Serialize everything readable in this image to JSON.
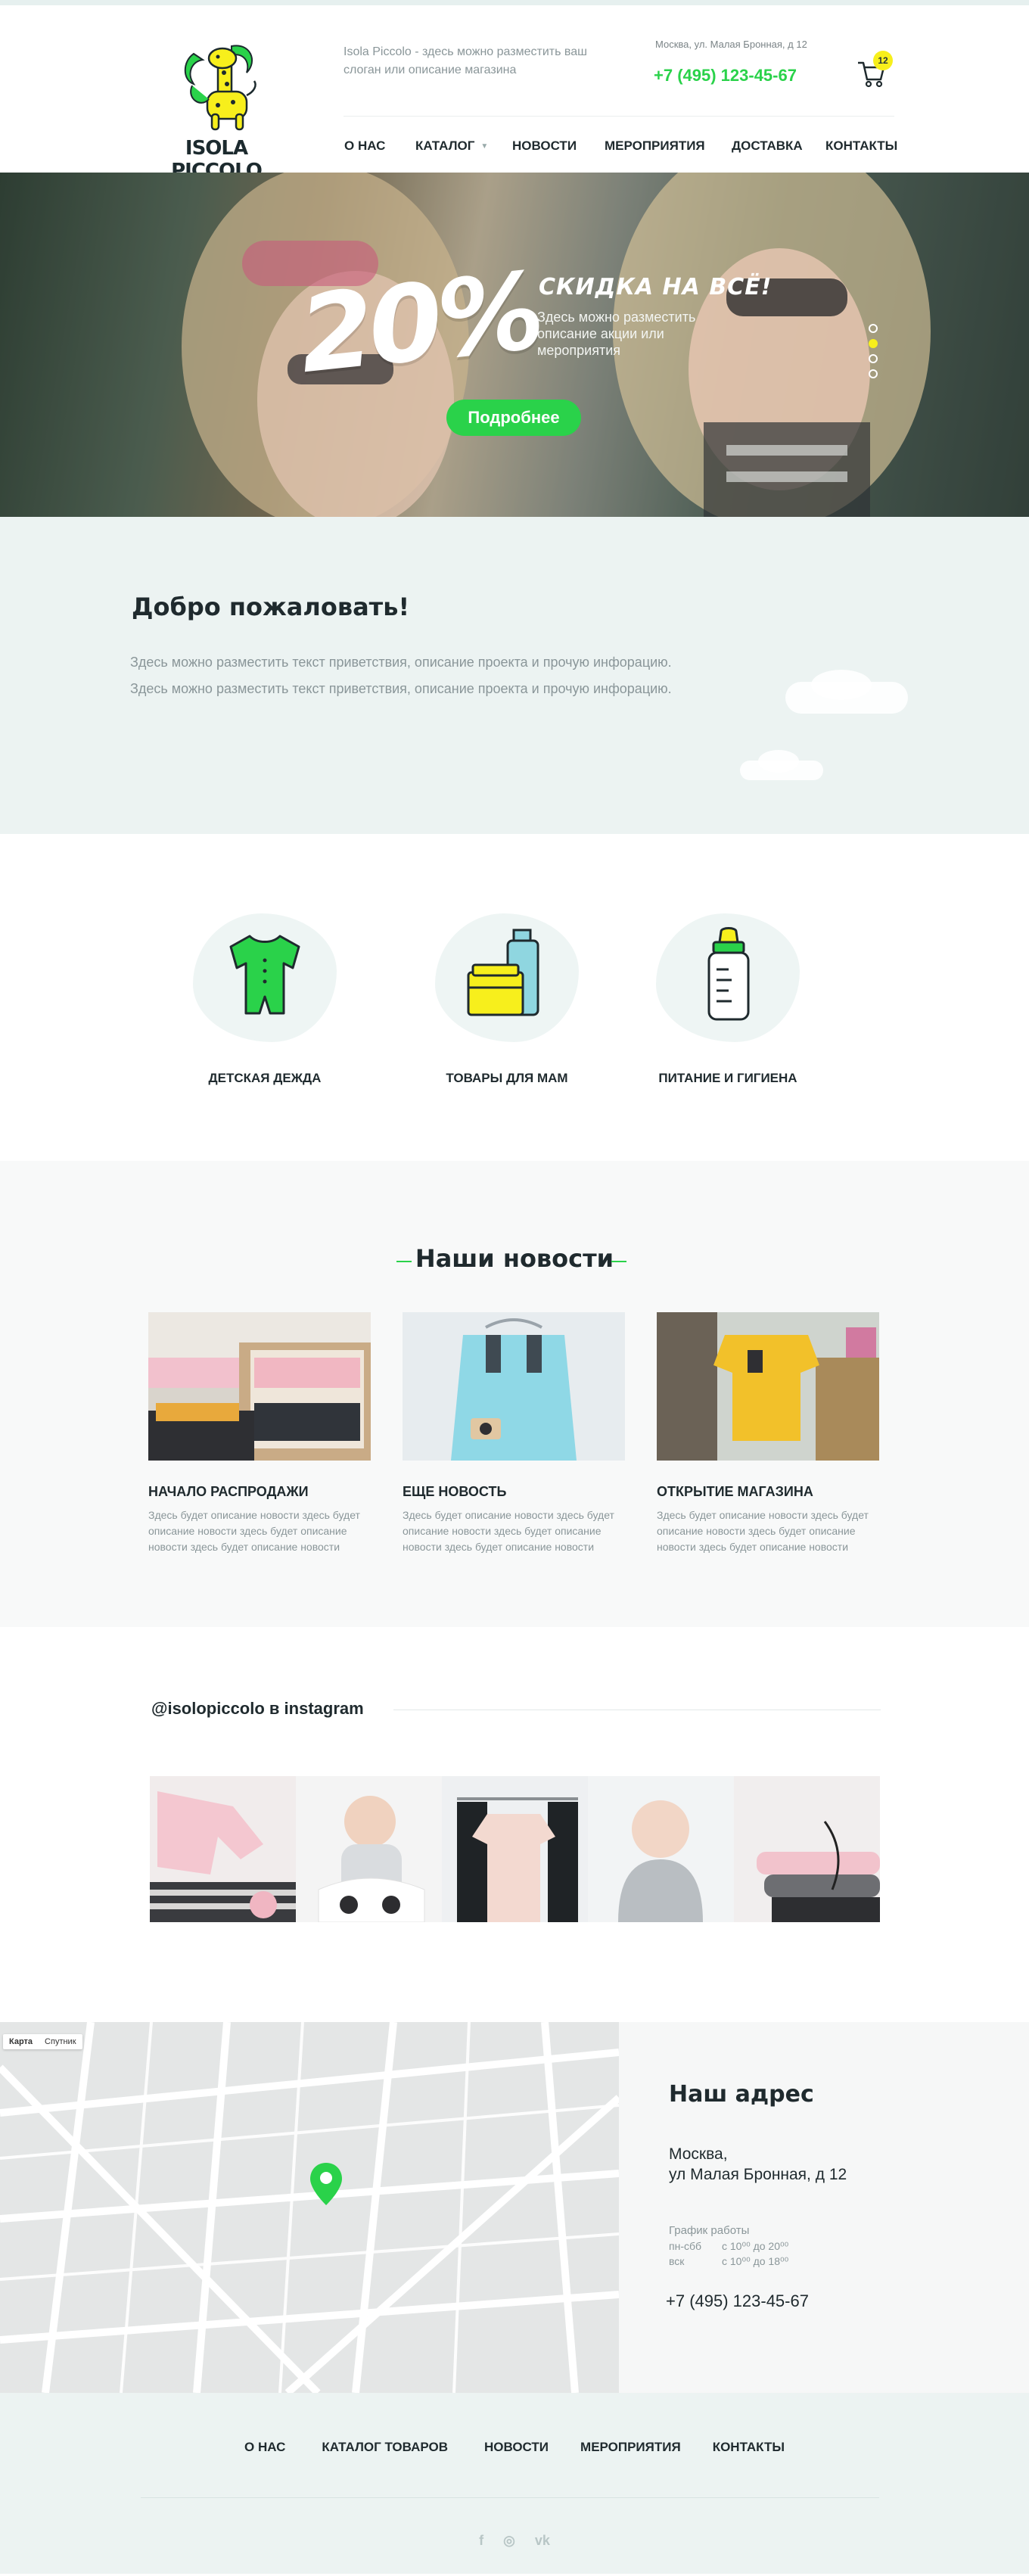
{
  "brand": {
    "name": "ISOLA PICCOLO"
  },
  "header": {
    "slogan": "Isola Piccolo - здесь можно разместить ваш слоган или описание магазина",
    "address": "Москва, ул. Малая Бронная, д 12",
    "phone": "+7 (495) 123-45-67",
    "cart_count": "12"
  },
  "nav": [
    {
      "label": "О НАС"
    },
    {
      "label": "КАТАЛОГ"
    },
    {
      "label": "НОВОСТИ"
    },
    {
      "label": "МЕРОПРИЯТИЯ"
    },
    {
      "label": "ДОСТАВКА"
    },
    {
      "label": "КОНТАКТЫ"
    }
  ],
  "hero": {
    "percent": "20%",
    "title": "СКИДКА НА ВСЁ!",
    "description": "Здесь можно разместить описание акции или мероприятия",
    "button": "Подробнее",
    "slides": 4,
    "active_slide": 2
  },
  "welcome": {
    "title": "Добро пожаловать!",
    "text": "Здесь можно разместить текст приветствия, описание проекта и прочую инфорацию. Здесь можно разместить текст приветствия, описание проекта и прочую инфорацию."
  },
  "categories": [
    {
      "label": "ДЕТСКАЯ ДЕЖДА",
      "icon": "baby-bodysuit-icon"
    },
    {
      "label": "ТОВАРЫ ДЛЯ МАМ",
      "icon": "cosmetics-icon"
    },
    {
      "label": "ПИТАНИЕ И ГИГИЕНА",
      "icon": "baby-bottle-icon"
    }
  ],
  "news": {
    "title": "Наши новости",
    "items": [
      {
        "title": "НАЧАЛО РАСПРОДАЖИ",
        "text": "Здесь будет описание новости здесь будет описание новости здесь будет описание новости здесь будет описание новости"
      },
      {
        "title": "ЕЩЕ НОВОСТЬ",
        "text": "Здесь будет описание новости здесь будет описание новости здесь будет описание новости здесь будет описание новости"
      },
      {
        "title": "ОТКРЫТИЕ МАГАЗИНА",
        "text": "Здесь будет описание новости здесь будет описание новости здесь будет описание новости здесь будет описание новости"
      }
    ]
  },
  "instagram": {
    "title": "@isolopiccolo в instagram"
  },
  "contact": {
    "map_tabs": [
      "Карта",
      "Спутник"
    ],
    "title": "Наш адрес",
    "city": "Москва,",
    "street": "ул Малая Бронная, д 12",
    "hours_title": "График работы",
    "hours": [
      {
        "days": "пн-сбб",
        "time": "с 10⁰⁰ до 20⁰⁰"
      },
      {
        "days": "вск",
        "time": "с 10⁰⁰ до 18⁰⁰"
      }
    ],
    "phone": "+7 (495) 123-45-67"
  },
  "footer": {
    "nav": [
      {
        "label": "О НАС"
      },
      {
        "label": "КАТАЛОГ ТОВАРОВ"
      },
      {
        "label": "НОВОСТИ"
      },
      {
        "label": "МЕРОПРИЯТИЯ"
      },
      {
        "label": "КОНТАКТЫ"
      }
    ],
    "social": [
      {
        "icon": "facebook-icon",
        "glyph": "f"
      },
      {
        "icon": "instagram-icon",
        "glyph": "◎"
      },
      {
        "icon": "vk-icon",
        "glyph": "vk"
      }
    ]
  },
  "colors": {
    "accent": "#2ad24a",
    "yellow": "#f7ef1c",
    "pale": "#ecf3f2",
    "dark": "#1f2a2e",
    "muted": "#8a9699"
  }
}
